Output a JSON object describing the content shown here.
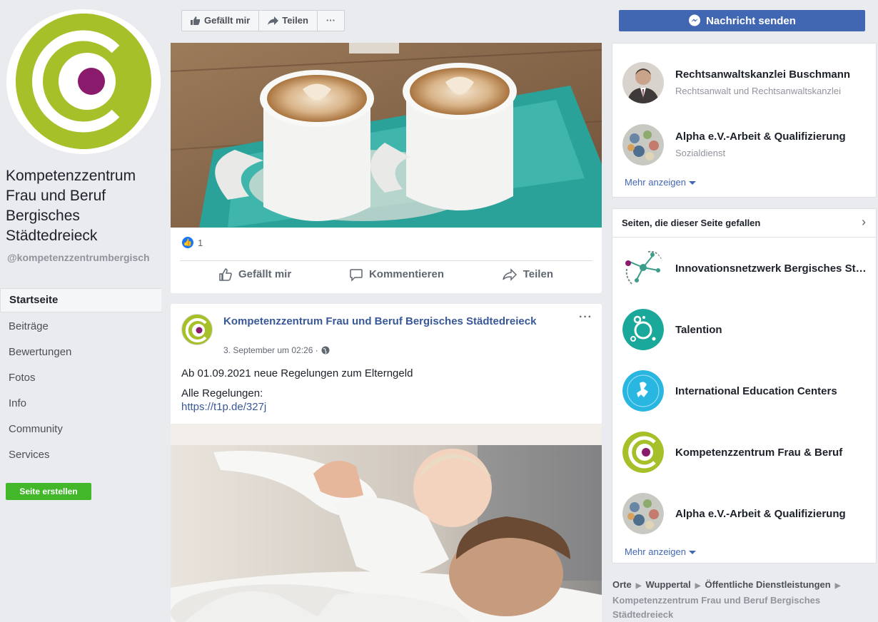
{
  "page": {
    "name": "Kompetenzzentrum Frau und Beruf Bergisches Städtedreieck",
    "handle": "@kompetenzzentrumbergisch"
  },
  "sidebar": {
    "items": [
      {
        "label": "Startseite",
        "active": true
      },
      {
        "label": "Beiträge"
      },
      {
        "label": "Bewertungen"
      },
      {
        "label": "Fotos"
      },
      {
        "label": "Info"
      },
      {
        "label": "Community"
      },
      {
        "label": "Services"
      }
    ],
    "create_page": "Seite erstellen"
  },
  "toolbar": {
    "like": "Gefällt mir",
    "share": "Teilen",
    "more": "···"
  },
  "post1": {
    "like_count": "1",
    "actions": {
      "like": "Gefällt mir",
      "comment": "Kommentieren",
      "share": "Teilen"
    }
  },
  "post2": {
    "author": "Kompetenzzentrum Frau und Beruf Bergisches Städtedreieck",
    "time": "3. September um 02:26 ·",
    "more": "···",
    "text1": "Ab 01.09.2021 neue Regelungen zum Elterngeld",
    "text2": "Alle Regelungen:",
    "link": "https://t1p.de/327j"
  },
  "right": {
    "message_button": "Nachricht senden",
    "suggestions": [
      {
        "name": "Rechtsanwaltskanzlei Buschmann",
        "category": "Rechtsanwalt und Rechtsanwaltskanzlei"
      },
      {
        "name": "Alpha e.V.-Arbeit & Qualifizierung",
        "category": "Sozialdienst"
      }
    ],
    "more1": "Mehr anzeigen",
    "liked_pages_title": "Seiten, die dieser Seite gefallen",
    "liked_pages": [
      {
        "name": "Innovationsnetzwerk Bergisches Städtedreieck"
      },
      {
        "name": "Talention"
      },
      {
        "name": "International Education Centers"
      },
      {
        "name": "Kompetenzzentrum Frau & Beruf"
      },
      {
        "name": "Alpha e.V.-Arbeit & Qualifizierung"
      }
    ],
    "more2": "Mehr anzeigen"
  },
  "breadcrumb": {
    "items": [
      "Orte",
      "Wuppertal",
      "Öffentliche Dienstleistungen"
    ],
    "current": "Kompetenzzentrum Frau und Beruf Bergisches Städtedreieck"
  },
  "colors": {
    "brand_green": "#a6c029",
    "brand_purple": "#8a1a6b",
    "fb_blue": "#4267b2",
    "create_green": "#42b72a"
  }
}
